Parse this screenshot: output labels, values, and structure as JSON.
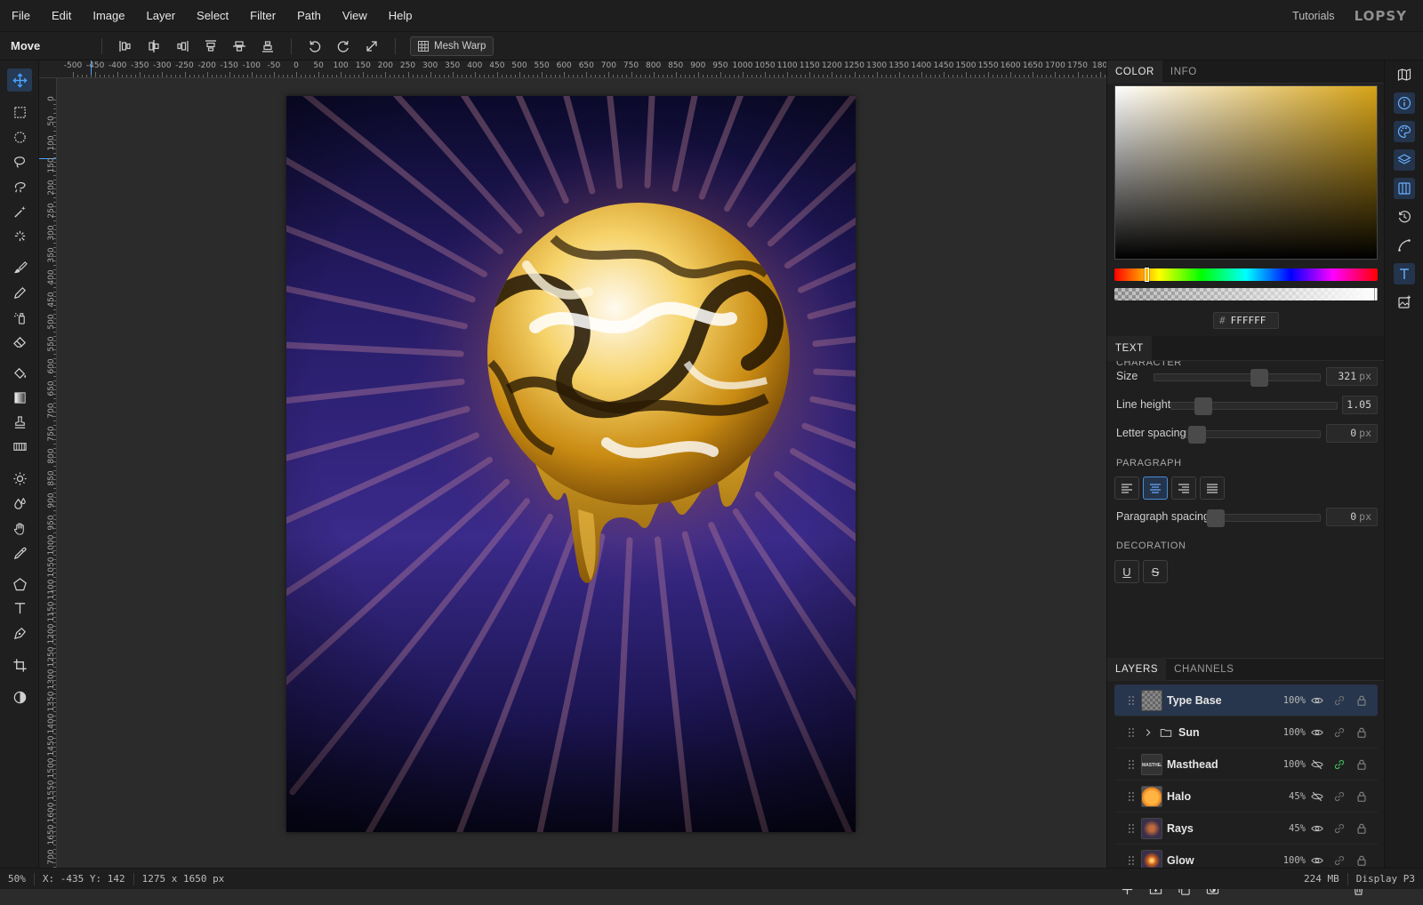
{
  "menu": {
    "items": [
      "File",
      "Edit",
      "Image",
      "Layer",
      "Select",
      "Filter",
      "Path",
      "View",
      "Help"
    ],
    "tutorials": "Tutorials",
    "logo": "LOPSY"
  },
  "options": {
    "tool_name": "Move",
    "mesh_warp": "Mesh Warp"
  },
  "ruler": {
    "h_labels": [
      "-500",
      "-450",
      "-400",
      "-350",
      "-300",
      "-250",
      "-200",
      "-150",
      "-100",
      "-50",
      "0",
      "50",
      "100",
      "150",
      "200",
      "250",
      "300",
      "350",
      "400",
      "450",
      "500",
      "550",
      "600",
      "650",
      "700",
      "750",
      "800",
      "850",
      "900",
      "950",
      "1000",
      "1050",
      "1100",
      "1150",
      "1200",
      "1250",
      "1300",
      "1350",
      "1400",
      "1450",
      "1500",
      "1550",
      "1600",
      "1650",
      "1700",
      "1750",
      "180"
    ],
    "v_labels": [
      "0",
      "50",
      "100",
      "150",
      "200",
      "250",
      "300",
      "350",
      "400",
      "450",
      "500",
      "550",
      "600",
      "650",
      "700",
      "750",
      "800",
      "850",
      "900",
      "950",
      "1000",
      "1050",
      "1100",
      "1150",
      "1200",
      "1250",
      "1300",
      "1350",
      "1400",
      "1450",
      "1500",
      "1550",
      "1600",
      "1650",
      "700"
    ]
  },
  "color_panel": {
    "tabs": [
      "COLOR",
      "INFO"
    ],
    "base_hue_color": "#d6a317",
    "hex_value": "FFFFFF"
  },
  "text_panel": {
    "tab": "TEXT",
    "character_label": "CHARACTER",
    "size_label": "Size",
    "size_value": "321",
    "size_unit": "px",
    "line_height_label": "Line height",
    "line_height_value": "1.05",
    "letter_spacing_label": "Letter spacing",
    "letter_spacing_value": "0",
    "letter_spacing_unit": "px",
    "paragraph_label": "PARAGRAPH",
    "paragraph_spacing_label": "Paragraph spacing",
    "paragraph_spacing_value": "0",
    "paragraph_spacing_unit": "px",
    "decoration_label": "DECORATION",
    "underline_glyph": "U",
    "strike_glyph": "S"
  },
  "layers_panel": {
    "tabs": [
      "LAYERS",
      "CHANNELS"
    ],
    "layers": [
      {
        "name": "Type Base",
        "opacity": "100%",
        "visible": true,
        "selected": true
      },
      {
        "name": "Sun",
        "opacity": "100%",
        "visible": true,
        "group": true
      },
      {
        "name": "Masthead",
        "opacity": "100%",
        "visible": false,
        "linked": true
      },
      {
        "name": "Halo",
        "opacity": "45%",
        "visible": false
      },
      {
        "name": "Rays",
        "opacity": "45%",
        "visible": true
      },
      {
        "name": "Glow",
        "opacity": "100%",
        "visible": true
      }
    ]
  },
  "status": {
    "zoom": "50%",
    "coords": "X: -435 Y: 142",
    "doc_size": "1275 x 1650 px",
    "memory": "224 MB",
    "color_profile": "Display P3"
  },
  "colors": {
    "accent": "#4a8ad8",
    "canvas_bg_top": "#0c0a2e",
    "canvas_bg_mid": "#2d1f75",
    "gold": "#d9a520"
  }
}
